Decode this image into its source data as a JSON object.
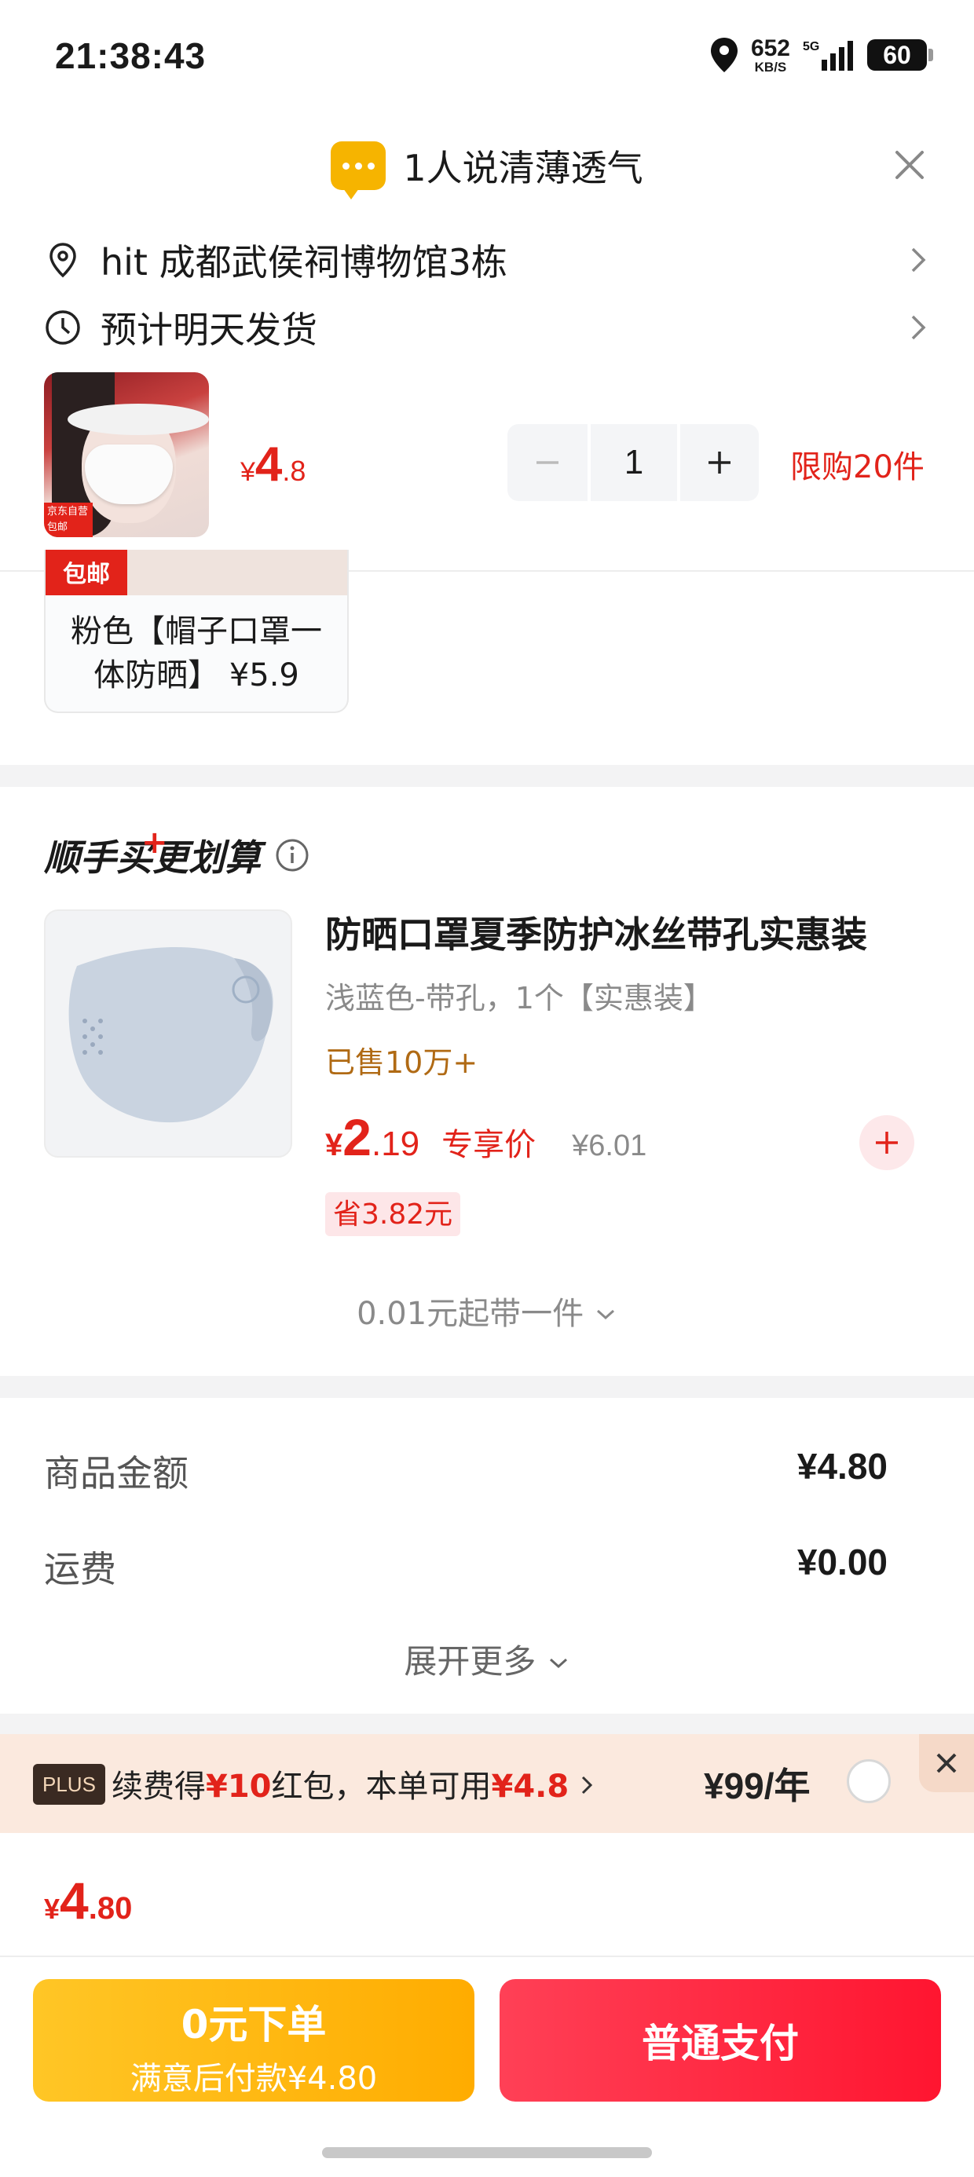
{
  "status_bar": {
    "time": "21:38:43",
    "net_speed": "652",
    "net_unit": "KB/S",
    "signal_label": "5G",
    "battery": "60"
  },
  "header": {
    "tip_text": "1人说清薄透气"
  },
  "address": {
    "text": "hit  成都武侯祠博物馆3栋"
  },
  "delivery": {
    "text": "预计明天发货"
  },
  "product": {
    "thumb_tag": "京东自营 包邮",
    "price_symbol": "¥",
    "price_int": "4",
    "price_dec": ".8",
    "quantity": "1",
    "limit": "限购20件"
  },
  "variant": {
    "badge": "包邮",
    "label": "粉色【帽子口罩一体防晒】 ¥5.9"
  },
  "bundle": {
    "title": "顺手买更划算",
    "plus_mark": "+",
    "item": {
      "title": "防晒口罩夏季防护冰丝带孔实惠装",
      "spec": "浅蓝色-带孔，1个【实惠装】",
      "sold": "已售10万+",
      "price_symbol": "¥",
      "price_int": "2",
      "price_dec": ".19",
      "exclusive_label": "专享价",
      "orig_price": "¥6.01",
      "save": "省3.82元"
    },
    "more": "0.01元起带一件"
  },
  "summary": {
    "goods_label": "商品金额",
    "goods_value": "¥4.80",
    "shipping_label": "运费",
    "shipping_value": "¥0.00",
    "expand": "展开更多"
  },
  "plus": {
    "badge": "PLUS",
    "text_1": "续费得",
    "text_red_1": "¥10",
    "text_2": "红包，本单可用",
    "text_red_2": "¥4.8",
    "price": "¥99/年"
  },
  "total": {
    "symbol": "¥",
    "int": "4",
    "dec": ".80"
  },
  "buttons": {
    "zero_title": "0元下单",
    "zero_sub": "满意后付款¥4.80",
    "pay": "普通支付"
  },
  "colors": {
    "accent_red": "#e2231a",
    "yellow": "#ffb800"
  }
}
